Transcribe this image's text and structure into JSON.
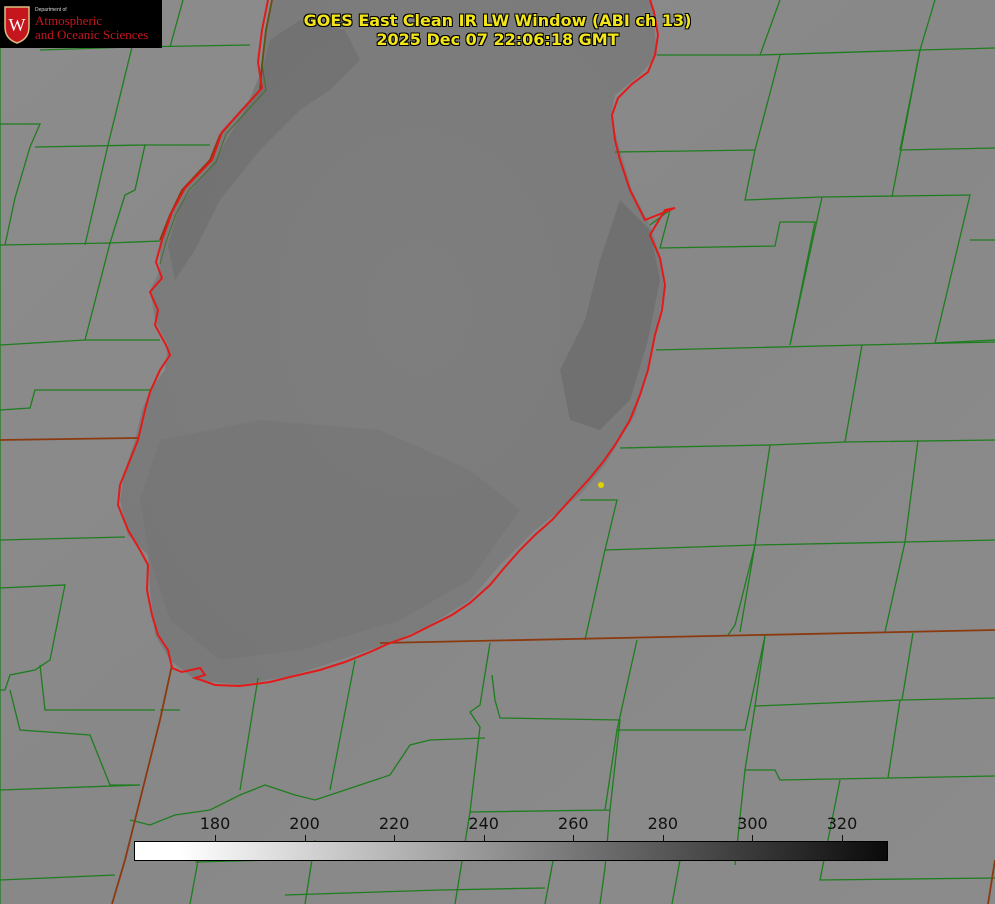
{
  "title": {
    "line1": "GOES East Clean IR LW Window (ABI ch 13)",
    "line2": "2025 Dec 07 22:06:18 GMT"
  },
  "logo": {
    "department": "Department of",
    "line1": "Atmospheric",
    "line2": "and Oceanic Sciences",
    "seal_letter": "W"
  },
  "colorbar": {
    "ticks": [
      "180",
      "200",
      "220",
      "240",
      "260",
      "280",
      "300",
      "320"
    ],
    "range": [
      162,
      330
    ],
    "colormap": "white-to-black"
  },
  "colors": {
    "county_lines": "#1e7d1e",
    "state_lines": "#8b3a10",
    "lake_outline": "#e31a1a",
    "title_text": "#f2e61a",
    "marker": "#e0d000",
    "background_gray": "#8a8a8a",
    "lake_gray": "#7a7a7a"
  },
  "map": {
    "features": [
      "county-boundaries",
      "state-boundaries",
      "lake-shoreline",
      "station-marker"
    ]
  }
}
